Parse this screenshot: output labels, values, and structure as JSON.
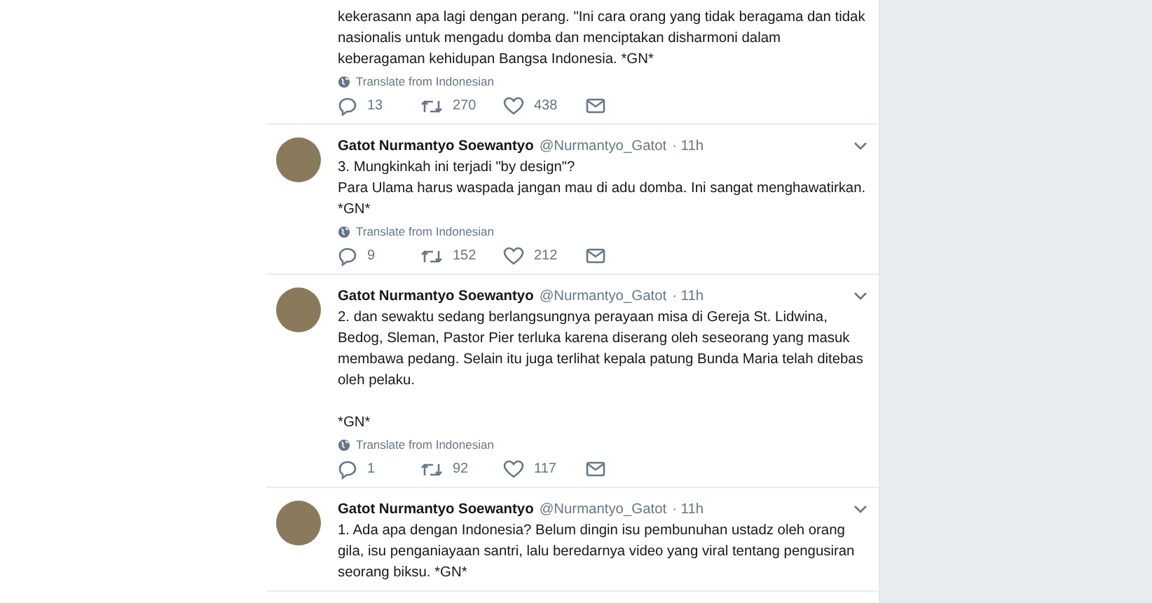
{
  "tweets": [
    {
      "text": "kekerasann apa lagi dengan perang. \"Ini cara orang yang tidak beragama dan tidak nasionalis untuk mengadu domba dan menciptakan disharmoni dalam keberagaman kehidupan Bangsa Indonesia. *GN*",
      "translate": "Translate from Indonesian",
      "replies": "13",
      "retweets": "270",
      "likes": "438"
    },
    {
      "author": "Gatot Nurmantyo Soewantyo",
      "handle": "@Nurmantyo_Gatot",
      "time": "· 11h",
      "text": "3. Mungkinkah ini terjadi \"by design\"?\nPara Ulama harus waspada jangan mau di adu domba. Ini sangat menghawatirkan. *GN*",
      "translate": "Translate from Indonesian",
      "replies": "9",
      "retweets": "152",
      "likes": "212"
    },
    {
      "author": "Gatot Nurmantyo Soewantyo",
      "handle": "@Nurmantyo_Gatot",
      "time": "· 11h",
      "text": "2. dan sewaktu sedang berlangsungnya perayaan misa di Gereja St. Lidwina, Bedog, Sleman, Pastor Pier terluka karena diserang oleh seseorang yang masuk membawa pedang. Selain itu juga terlihat kepala patung Bunda Maria telah ditebas oleh pelaku.\n\n*GN*",
      "translate": "Translate from Indonesian",
      "replies": "1",
      "retweets": "92",
      "likes": "117"
    },
    {
      "author": "Gatot Nurmantyo Soewantyo",
      "handle": "@Nurmantyo_Gatot",
      "time": "· 11h",
      "text": "1. Ada apa dengan Indonesia? Belum dingin isu pembunuhan ustadz oleh orang gila, isu penganiayaan santri, lalu beredarnya video yang viral tentang pengusiran seorang biksu. *GN*"
    }
  ]
}
